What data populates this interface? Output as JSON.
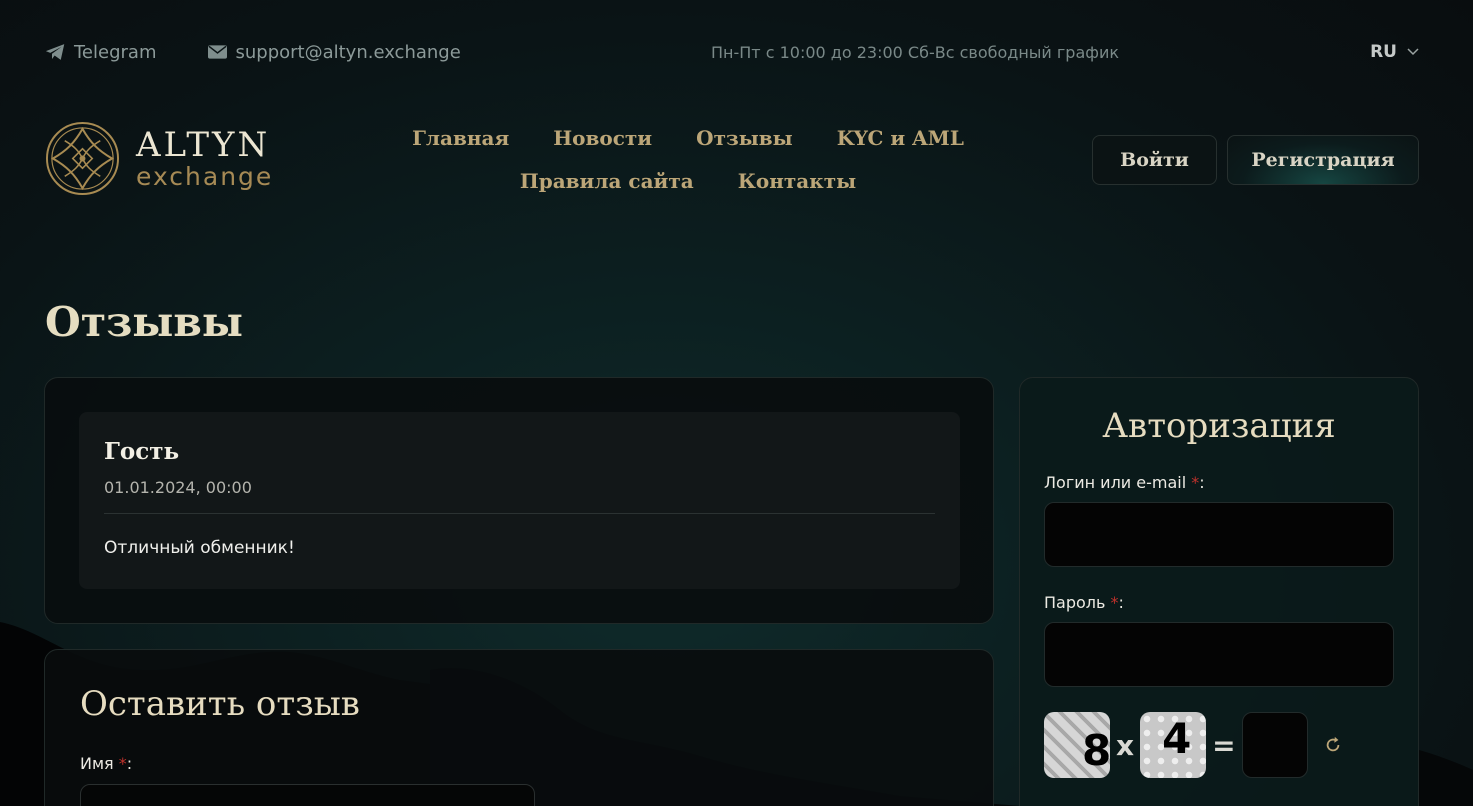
{
  "topbar": {
    "telegram_label": "Telegram",
    "email_label": "support@altyn.exchange",
    "schedule": "Пн-Пт с 10:00 до 23:00 Сб-Вс свободный график",
    "language": "RU"
  },
  "logo": {
    "line1": "ALTYN",
    "line2": "exchange"
  },
  "nav": {
    "items": [
      "Главная",
      "Новости",
      "Отзывы",
      "KYC и AML",
      "Правила сайта",
      "Контакты"
    ]
  },
  "header_buttons": {
    "login": "Войти",
    "register": "Регистрация"
  },
  "page": {
    "title": "Отзывы"
  },
  "review": {
    "name": "Гость",
    "date": "01.01.2024, 00:00",
    "text": "Отличный обменник!"
  },
  "leave_review": {
    "title": "Оставить отзыв",
    "name_label": "Имя",
    "required_mark": "*",
    "colon": ":"
  },
  "auth": {
    "title": "Авторизация",
    "login_label": "Логин или e-mail",
    "password_label": "Пароль",
    "required_mark": "*",
    "colon": ":",
    "captcha_a": "8",
    "captcha_op": "x",
    "captcha_b": "4",
    "captcha_eq": "="
  },
  "colors": {
    "accent_gold": "#bca678",
    "required_red": "#c0322c"
  },
  "icons": {
    "telegram": "telegram-icon",
    "email": "mail-icon",
    "language_dropdown": "chevron-down-icon",
    "logo": "logo-emblem-icon",
    "captcha_refresh": "refresh-icon"
  }
}
